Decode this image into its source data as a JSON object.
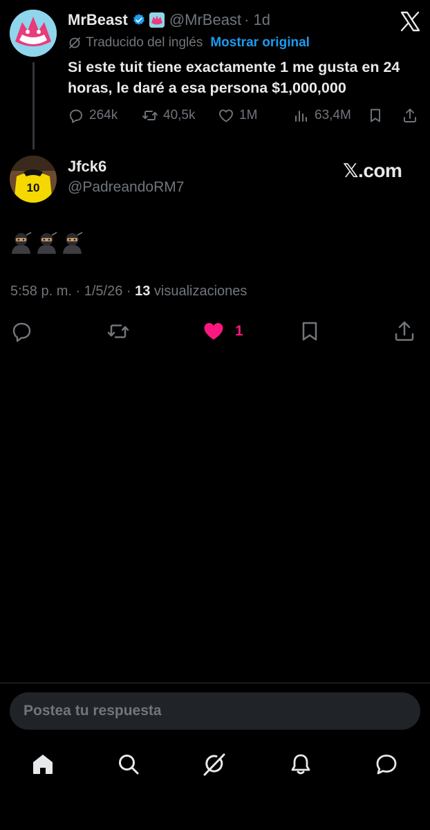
{
  "parent_tweet": {
    "name": "MrBeast",
    "handle": "@MrBeast",
    "time": "· 1d",
    "translated_label": "Traducido del inglés",
    "show_original_link": "Mostrar original",
    "text": "Si este tuit tiene exactamente 1 me gusta en 24 horas, le daré a esa persona $1,000,000",
    "replies": "264k",
    "reposts": "40,5k",
    "likes": "1M",
    "views": "63,4M"
  },
  "reply_tweet": {
    "name": "Jfck6",
    "handle": "@PadreandoRM7",
    "source_label": "𝕏.com",
    "emoji_text": "🥷🥷🥷",
    "timestamp": "5:58 p. m. · 1/5/26 · ",
    "views_count": "13",
    "views_label": " visualizaciones",
    "like_count": "1",
    "liked": true
  },
  "composer": {
    "placeholder": "Postea tu respuesta"
  },
  "bottom_nav": [
    "home-icon",
    "search-icon",
    "grok-icon",
    "notifications-icon",
    "messages-icon"
  ],
  "colors": {
    "background": "#000000",
    "accent": "#1d9bf0",
    "like": "#f91880",
    "muted": "#71767b",
    "text": "#e7e9ea"
  }
}
